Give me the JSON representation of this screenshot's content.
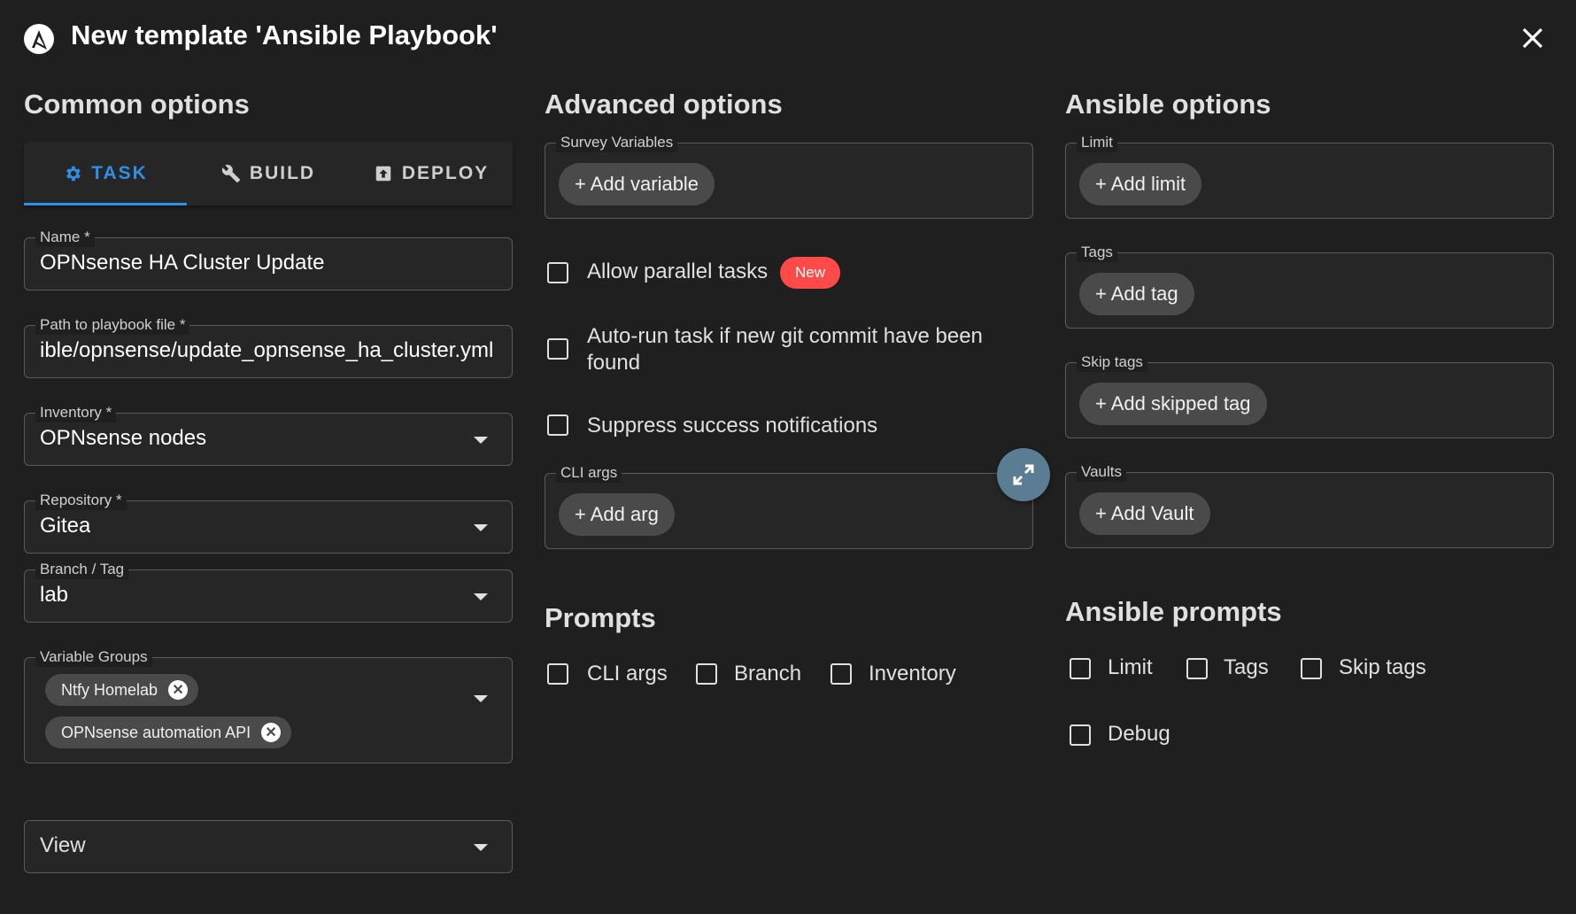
{
  "header": {
    "title": "New template 'Ansible Playbook'"
  },
  "common": {
    "section_title": "Common options",
    "tabs": [
      {
        "label": "TASK"
      },
      {
        "label": "BUILD"
      },
      {
        "label": "DEPLOY"
      }
    ],
    "name": {
      "label": "Name *",
      "value": "OPNsense HA Cluster Update"
    },
    "playbook": {
      "label": "Path to playbook file *",
      "value": "ible/opnsense/update_opnsense_ha_cluster.yml"
    },
    "inventory": {
      "label": "Inventory *",
      "value": "OPNsense nodes"
    },
    "repository": {
      "label": "Repository *",
      "value": "Gitea"
    },
    "branch": {
      "label": "Branch / Tag",
      "value": "lab"
    },
    "variable_groups": {
      "label": "Variable Groups",
      "chips": [
        "Ntfy Homelab",
        "OPNsense automation API"
      ]
    },
    "view": {
      "value": "View"
    }
  },
  "advanced": {
    "section_title": "Advanced options",
    "survey": {
      "label": "Survey Variables",
      "button": "+ Add variable"
    },
    "allow_parallel": {
      "label": "Allow parallel tasks",
      "badge": "New"
    },
    "autorun": {
      "label_line1": "Auto-run task if new git commit have been",
      "label_line2": "found"
    },
    "suppress": {
      "label": "Suppress success notifications"
    },
    "cli_args": {
      "label": "CLI args",
      "button": "+ Add arg"
    },
    "prompts_title": "Prompts",
    "prompts": {
      "cli_args": "CLI args",
      "branch": "Branch",
      "inventory": "Inventory"
    }
  },
  "ansible": {
    "section_title": "Ansible options",
    "limit": {
      "label": "Limit",
      "button": "+ Add limit"
    },
    "tags": {
      "label": "Tags",
      "button": "+ Add tag"
    },
    "skip_tags": {
      "label": "Skip tags",
      "button": "+ Add skipped tag"
    },
    "vaults": {
      "label": "Vaults",
      "button": "+ Add Vault"
    },
    "prompts_title": "Ansible prompts",
    "prompts": {
      "limit": "Limit",
      "tags": "Tags",
      "skip_tags": "Skip tags",
      "debug": "Debug"
    }
  },
  "colors": {
    "accent": "#2f8fe8",
    "badge": "#ff4a4a",
    "background": "#1f1f1f"
  },
  "icons": [
    "ansible-logo-icon",
    "close-icon",
    "gear-icon",
    "wrench-icon",
    "upload-icon",
    "chevron-down-icon",
    "expand-icon",
    "remove-chip-icon"
  ]
}
